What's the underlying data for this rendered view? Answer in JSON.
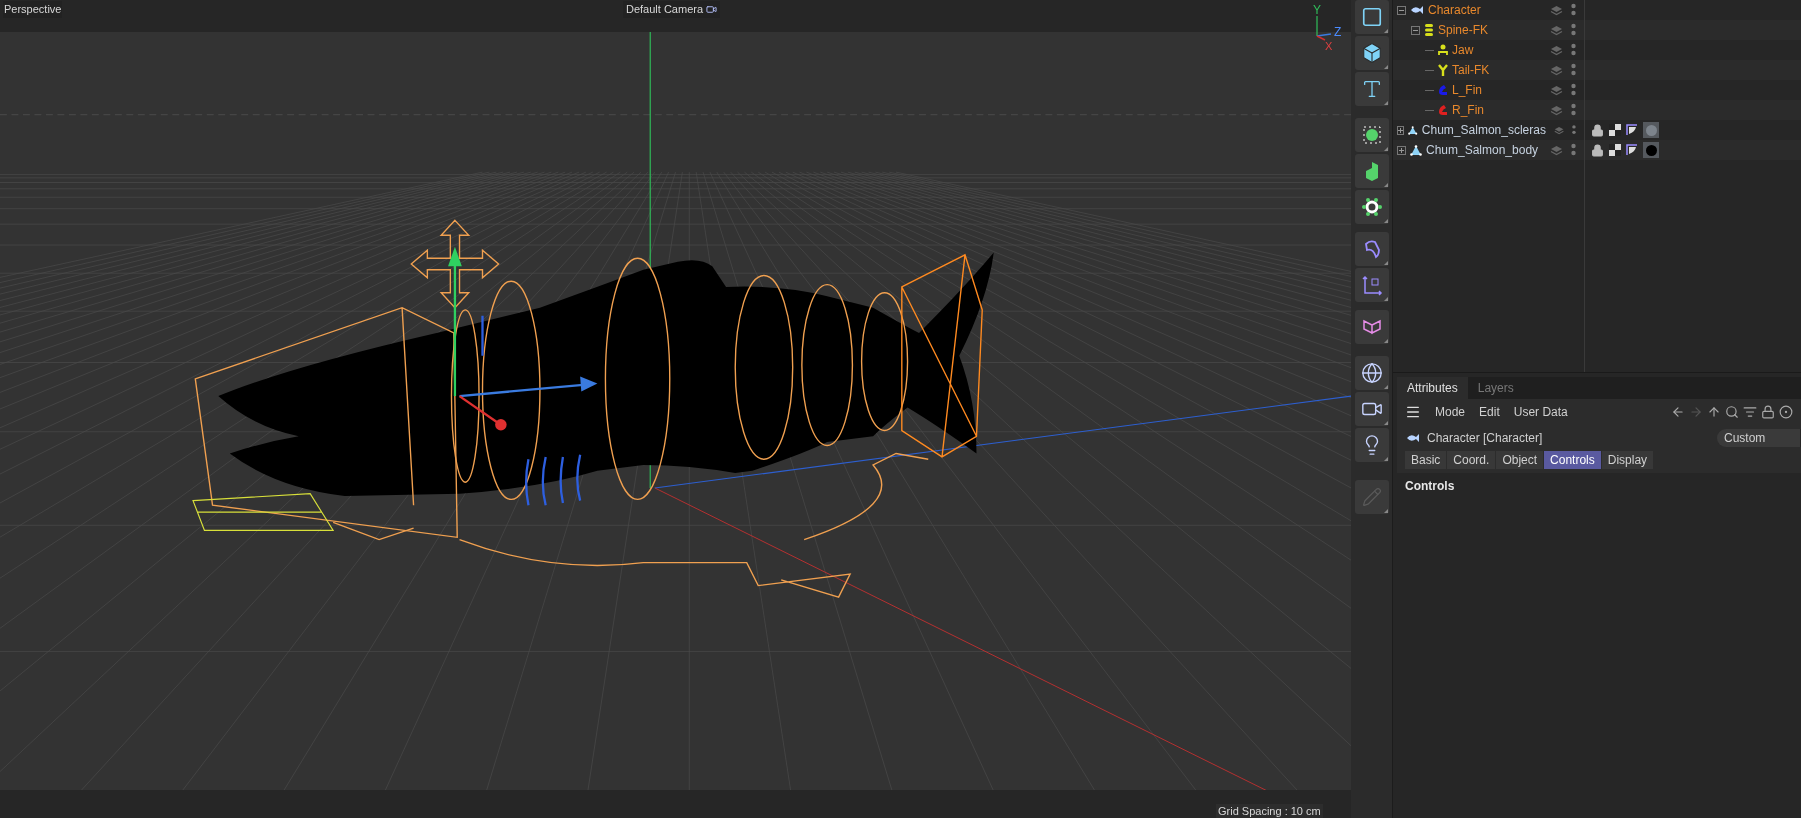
{
  "viewport": {
    "view_name": "Perspective",
    "camera": "Default Camera",
    "grid_spacing": "Grid Spacing : 10 cm",
    "axis_labels": [
      "Y",
      "Z",
      "X"
    ]
  },
  "objects": [
    {
      "name": "Character",
      "kind": "character",
      "selected": true,
      "expanded": true,
      "children": [
        {
          "name": "Spine-FK",
          "kind": "spine",
          "color": "#d8e01c",
          "selected": true,
          "expanded": true,
          "children": [
            {
              "name": "Jaw",
              "kind": "jaw",
              "color": "#d8e01c",
              "selected": true
            },
            {
              "name": "Tail-FK",
              "kind": "tail",
              "color": "#d8e01c",
              "selected": true
            },
            {
              "name": "L_Fin",
              "kind": "fin",
              "color": "#1a1ae8",
              "selected": true
            },
            {
              "name": "R_Fin",
              "kind": "fin",
              "color": "#e02020",
              "selected": true
            }
          ]
        }
      ]
    },
    {
      "name": "Chum_Salmon_scleras",
      "kind": "mesh",
      "selected": false,
      "expanded": false,
      "color": "#7d848c"
    },
    {
      "name": "Chum_Salmon_body",
      "kind": "mesh",
      "selected": false,
      "expanded": false,
      "color": "#000000"
    }
  ],
  "attributes": {
    "tabs": [
      {
        "label": "Attributes",
        "selected": true
      },
      {
        "label": "Layers",
        "selected": false
      }
    ],
    "menu": [
      "Mode",
      "Edit",
      "User Data"
    ],
    "object_title": "Character [Character]",
    "mode_select": "Custom",
    "subtabs": [
      {
        "label": "Basic",
        "selected": false
      },
      {
        "label": "Coord.",
        "selected": false
      },
      {
        "label": "Object",
        "selected": false
      },
      {
        "label": "Controls",
        "selected": true
      },
      {
        "label": "Display",
        "selected": false
      }
    ],
    "section": "Controls"
  }
}
